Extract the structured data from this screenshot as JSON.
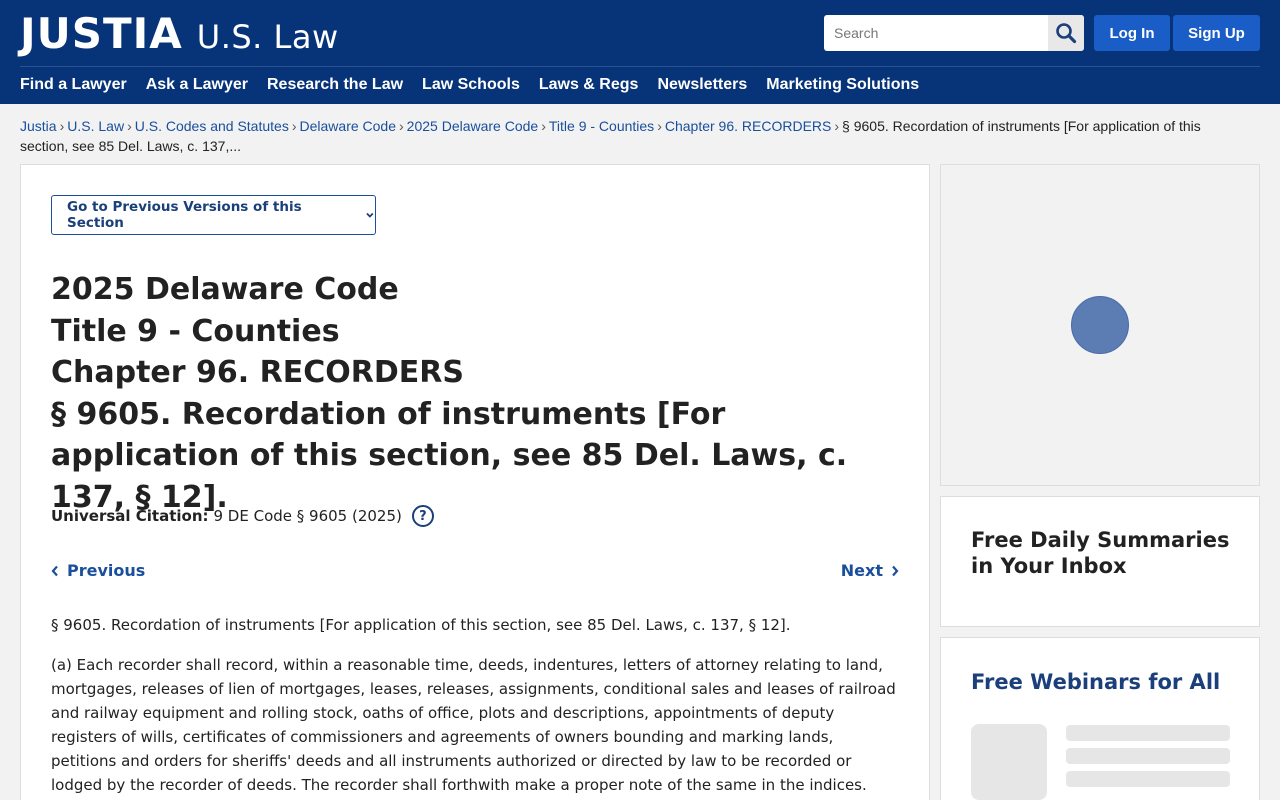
{
  "header": {
    "logo_main": "JUSTIA",
    "logo_sub": "U.S. Law",
    "search_placeholder": "Search",
    "login_label": "Log In",
    "signup_label": "Sign Up",
    "nav": [
      "Find a Lawyer",
      "Ask a Lawyer",
      "Research the Law",
      "Law Schools",
      "Laws & Regs",
      "Newsletters",
      "Marketing Solutions"
    ]
  },
  "breadcrumb": {
    "items": [
      "Justia",
      "U.S. Law",
      "U.S. Codes and Statutes",
      "Delaware Code",
      "2025 Delaware Code",
      "Title 9 - Counties",
      "Chapter 96. RECORDERS"
    ],
    "current": "§ 9605. Recordation of instruments [For application of this section, see 85 Del. Laws, c. 137,..."
  },
  "main": {
    "prev_versions_label": "Go to Previous Versions of this Section",
    "title_lines": [
      "2025 Delaware Code",
      "Title 9 - Counties",
      "Chapter 96. RECORDERS",
      "§ 9605. Recordation of instruments [For application of this section, see 85 Del. Laws, c. 137, § 12]."
    ],
    "citation_label": "Universal Citation:",
    "citation_value": "9 DE Code § 9605 (2025)",
    "help_label": "?",
    "previous_label": "Previous",
    "next_label": "Next",
    "section_heading": "§ 9605. Recordation of instruments [For application of this section, see 85 Del. Laws, c. 137, § 12].",
    "section_body": "(a) Each recorder shall record, within a reasonable time, deeds, indentures, letters of attorney relating to land, mortgages, releases of lien of mortgages, leases, releases, assignments, conditional sales and leases of railroad and railway equipment and rolling stock, oaths of office, plots and descriptions, appointments of deputy registers of wills, certificates of commissioners and agreements of owners bounding and marking lands, petitions and orders for sheriffs' deeds and all instruments authorized or directed by law to be recorded or lodged by the recorder of deeds. The recorder shall forthwith make a proper note of the same in the indices."
  },
  "sidebar": {
    "newsletter_title": "Free Daily Summaries in Your Inbox",
    "webinar_title": "Free Webinars for All"
  },
  "colors": {
    "header_bg": "#073478",
    "button_bg": "#1b5dc6",
    "link": "#1a4f9c"
  }
}
